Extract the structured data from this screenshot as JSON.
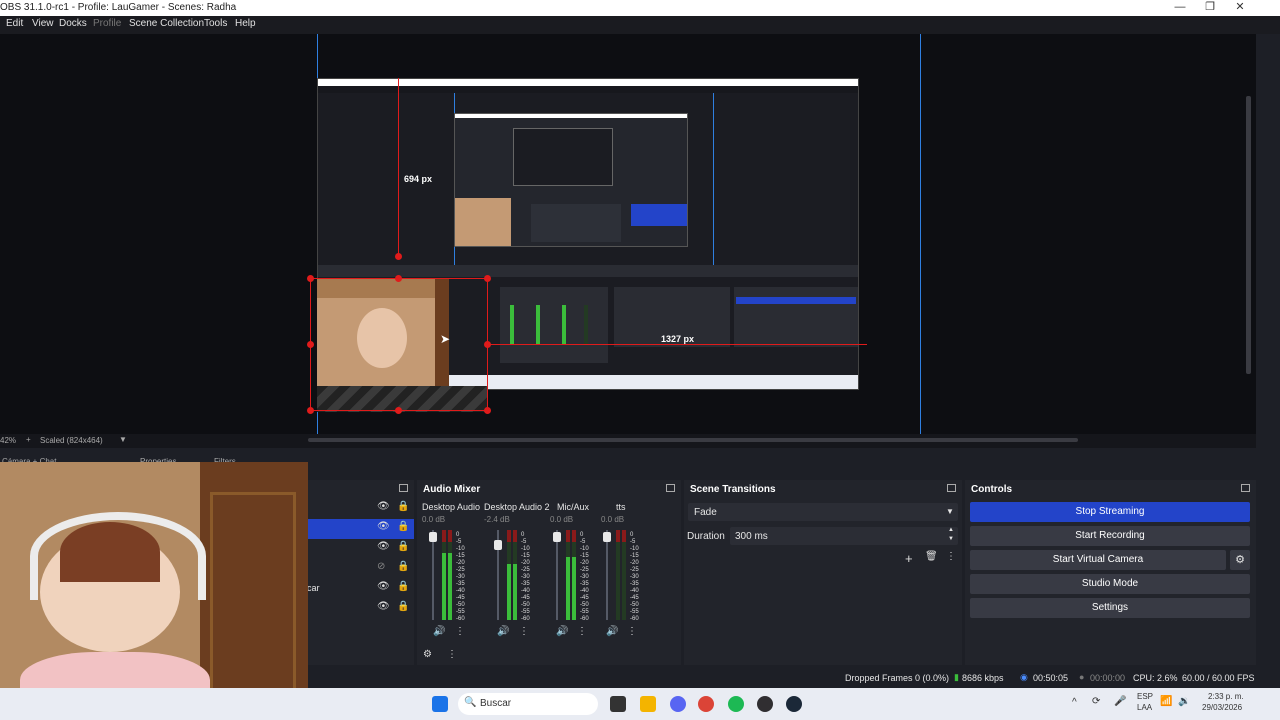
{
  "window": {
    "title": "OBS 31.1.0-rc1 - Profile: LauGamer - Scenes: Radha",
    "controls": [
      "—",
      "❐",
      "✕"
    ]
  },
  "menu": [
    "Edit",
    "View",
    "Docks",
    "Profile",
    "Scene Collection",
    "Tools",
    "Help"
  ],
  "preview": {
    "measure_vertical": "694 px",
    "measure_horizontal": "1327 px",
    "zoom": "42%",
    "scaled_label": "Scaled (824x464)"
  },
  "hidden_tabs": {
    "left": "Cámara + Chat",
    "properties": "Properties",
    "filters": "Filters"
  },
  "sources": {
    "partial_label": "car",
    "rows": [
      {
        "visible": "eye-icon"
      },
      {
        "visible": "eye-icon"
      },
      {
        "visible": "eye-icon"
      },
      {
        "visible": "eye-hidden-icon"
      },
      {
        "visible": "eye-icon"
      },
      {
        "visible": "eye-icon"
      }
    ]
  },
  "audio_mixer": {
    "title": "Audio Mixer",
    "channels": [
      {
        "name": "Desktop Audio",
        "db": "0.0 dB",
        "level": 0.75
      },
      {
        "name": "Desktop Audio 2",
        "db": "-2.4 dB",
        "level": 0.62
      },
      {
        "name": "Mic/Aux",
        "db": "0.0 dB",
        "level": 0.7
      },
      {
        "name": "tts",
        "db": "0.0 dB",
        "level": 0.0
      }
    ],
    "scale": [
      "0",
      "-5",
      "-10",
      "-15",
      "-20",
      "-25",
      "-30",
      "-35",
      "-40",
      "-45",
      "-50",
      "-55",
      "-60"
    ]
  },
  "scene_transitions": {
    "title": "Scene Transitions",
    "transition": "Fade",
    "duration_label": "Duration",
    "duration_value": "300 ms"
  },
  "controls": {
    "title": "Controls",
    "stop_streaming": "Stop Streaming",
    "start_recording": "Start Recording",
    "start_virtual_camera": "Start Virtual Camera",
    "studio_mode": "Studio Mode",
    "settings": "Settings"
  },
  "status": {
    "dropped_frames": "Dropped Frames 0 (0.0%)",
    "bitrate": "8686 kbps",
    "stream_time": "00:50:05",
    "record_time": "00:00:00",
    "cpu": "CPU: 2.6%",
    "fps": "60.00 / 60.00 FPS"
  },
  "taskbar": {
    "search_placeholder": "Buscar",
    "lang_top": "ESP",
    "lang_bottom": "LAA",
    "time": "2:33 p. m.",
    "date": "29/03/2026"
  },
  "colors": {
    "accent_blue": "#2344c9",
    "guide_blue": "#2f7fe0",
    "transform_red": "#e01b1b"
  }
}
